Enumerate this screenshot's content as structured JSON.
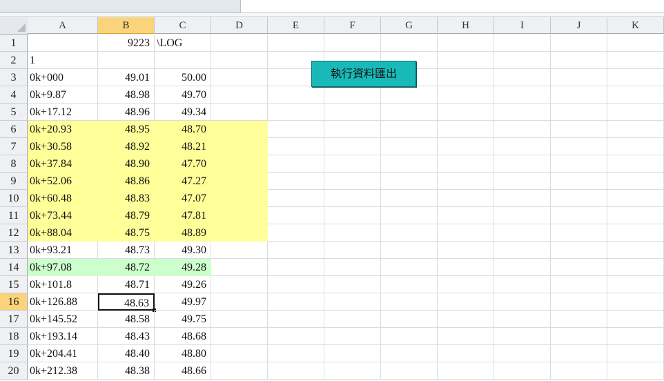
{
  "columns": [
    "A",
    "B",
    "C",
    "D",
    "E",
    "F",
    "G",
    "H",
    "I",
    "J",
    "K"
  ],
  "selected_column": "B",
  "rows": [
    {
      "n": "1",
      "a": "",
      "b": "9223",
      "c": "\\LOG",
      "fill": ""
    },
    {
      "n": "2",
      "a": "1",
      "b": "",
      "c": "",
      "fill": ""
    },
    {
      "n": "3",
      "a": "0k+000",
      "b": "49.01",
      "c": "50.00",
      "fill": ""
    },
    {
      "n": "4",
      "a": "0k+9.87",
      "b": "48.98",
      "c": "49.70",
      "fill": ""
    },
    {
      "n": "5",
      "a": "0k+17.12",
      "b": "48.96",
      "c": "49.34",
      "fill": ""
    },
    {
      "n": "6",
      "a": "0k+20.93",
      "b": "48.95",
      "c": "48.70",
      "fill": "yellow"
    },
    {
      "n": "7",
      "a": "0k+30.58",
      "b": "48.92",
      "c": "48.21",
      "fill": "yellow"
    },
    {
      "n": "8",
      "a": "0k+37.84",
      "b": "48.90",
      "c": "47.70",
      "fill": "yellow"
    },
    {
      "n": "9",
      "a": "0k+52.06",
      "b": "48.86",
      "c": "47.27",
      "fill": "yellow"
    },
    {
      "n": "10",
      "a": "0k+60.48",
      "b": "48.83",
      "c": "47.07",
      "fill": "yellow"
    },
    {
      "n": "11",
      "a": "0k+73.44",
      "b": "48.79",
      "c": "47.81",
      "fill": "yellow"
    },
    {
      "n": "12",
      "a": "0k+88.04",
      "b": "48.75",
      "c": "48.89",
      "fill": "yellow"
    },
    {
      "n": "13",
      "a": "0k+93.21",
      "b": "48.73",
      "c": "49.30",
      "fill": ""
    },
    {
      "n": "14",
      "a": "0k+97.08",
      "b": "48.72",
      "c": "49.28",
      "fill": "green"
    },
    {
      "n": "15",
      "a": "0k+101.8",
      "b": "48.71",
      "c": "49.26",
      "fill": ""
    },
    {
      "n": "16",
      "a": "0k+126.88",
      "b": "48.63",
      "c": "49.97",
      "fill": ""
    },
    {
      "n": "17",
      "a": "0k+145.52",
      "b": "48.58",
      "c": "49.75",
      "fill": ""
    },
    {
      "n": "18",
      "a": "0k+193.14",
      "b": "48.43",
      "c": "48.68",
      "fill": ""
    },
    {
      "n": "19",
      "a": "0k+204.41",
      "b": "48.40",
      "c": "48.80",
      "fill": ""
    },
    {
      "n": "20",
      "a": "0k+212.38",
      "b": "48.38",
      "c": "48.66",
      "fill": ""
    }
  ],
  "selected_row": "16",
  "active_cell": "B16",
  "macro_button": {
    "label": "執行資料匯出"
  },
  "colors": {
    "yellow_fill": "#ffff99",
    "green_fill": "#ccffcc",
    "button_fill": "#1ab9b9",
    "header_selected": "#f9d47a"
  }
}
